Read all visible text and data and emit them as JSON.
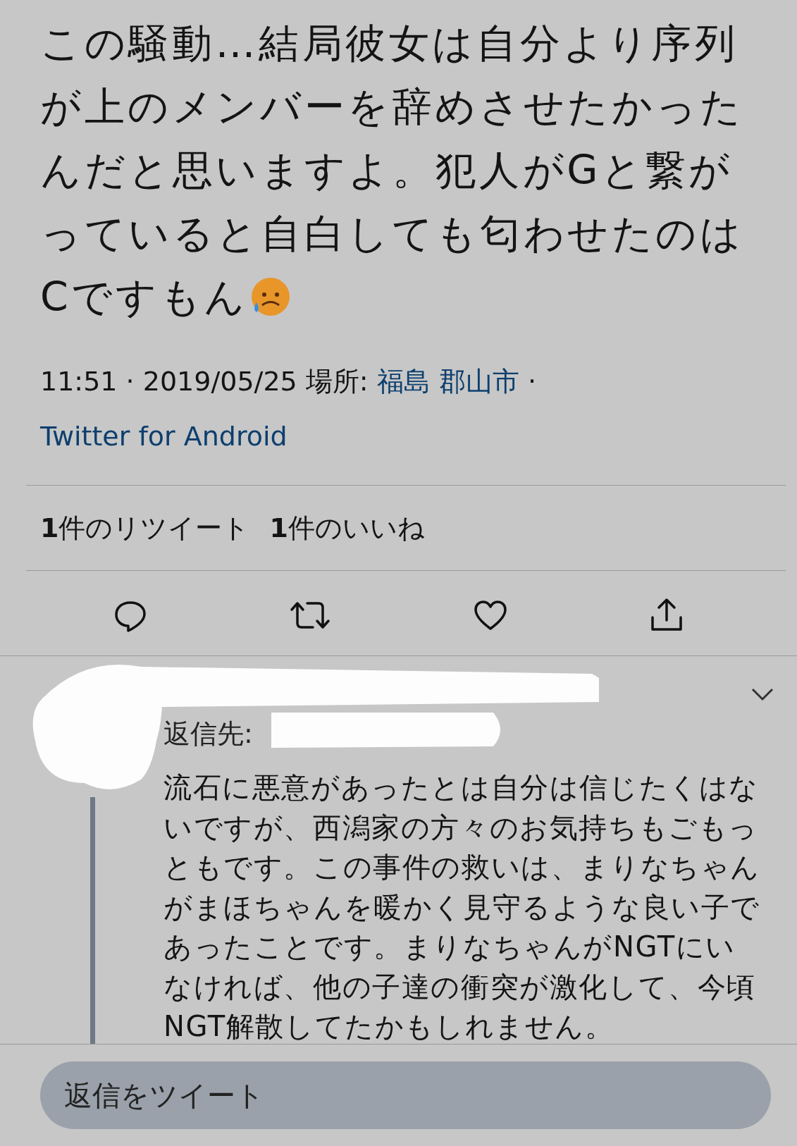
{
  "tweet": {
    "text": "この騒動…結局彼女は自分より序列が上のメンバーを辞めさせたかったんだと思いますよ。犯人がGと繋がっていると自白しても匂わせたのはCですもん",
    "meta": [
      {
        "kind": "plain",
        "text": "11:51 · 2019/05/25 場所: "
      },
      {
        "kind": "link",
        "text": "福島 郡山市"
      },
      {
        "kind": "plain",
        "text": " · "
      },
      {
        "kind": "link",
        "text": "Twitter for Android"
      }
    ],
    "stats": [
      "**1**件のリツイート",
      "**1**件のいいね"
    ],
    "actions": [
      {
        "kind": "reply"
      },
      {
        "kind": "retweet"
      },
      {
        "kind": "like"
      },
      {
        "kind": "share"
      }
    ]
  },
  "reply": {
    "replying_to": "返信先:",
    "text": "流石に悪意があったとは自分は信じたくはないですが、西潟家の方々のお気持ちもごもっともです。この事件の救いは、まりなちゃんがまほちゃんを暖かく見守るような良い子であったことです。まりなちゃんがNGTにいなければ、他の子達の衝突が激化して、今頃NGT解散してたかもしれません。"
  },
  "compose": {
    "placeholder": "返信をツイート"
  }
}
